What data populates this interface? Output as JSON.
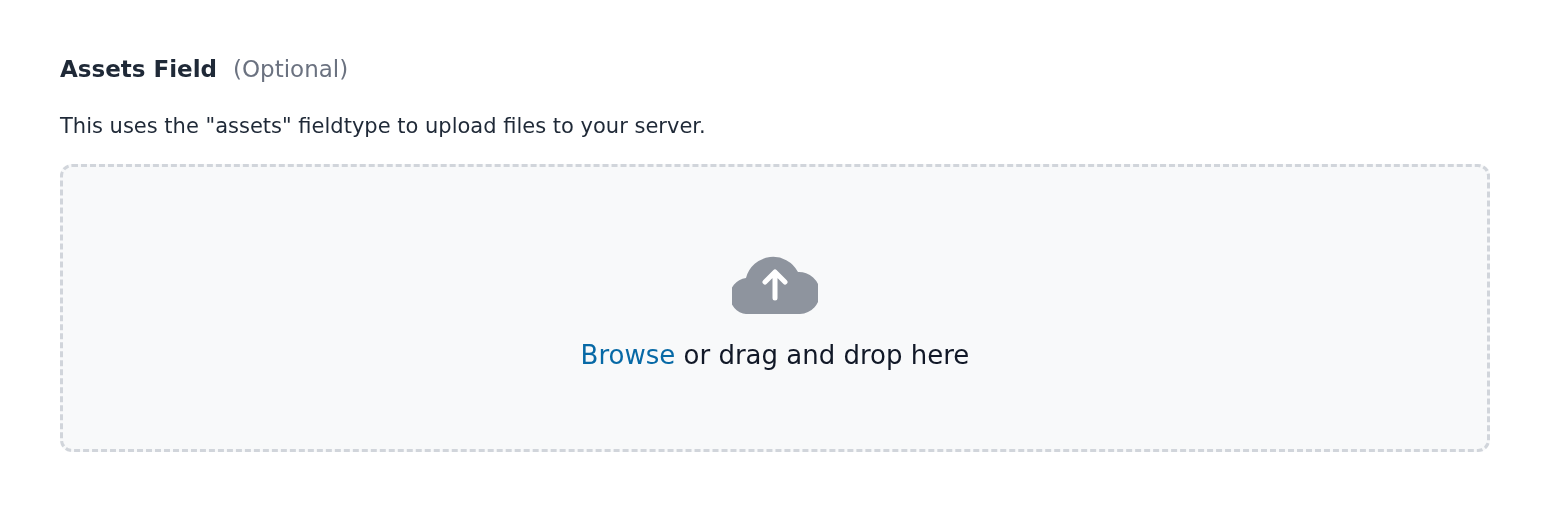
{
  "field": {
    "label": "Assets Field",
    "optional": "(Optional)",
    "description": "This uses the \"assets\" fieldtype to upload files to your server."
  },
  "dropzone": {
    "link": "Browse",
    "text": "or drag and drop here"
  }
}
